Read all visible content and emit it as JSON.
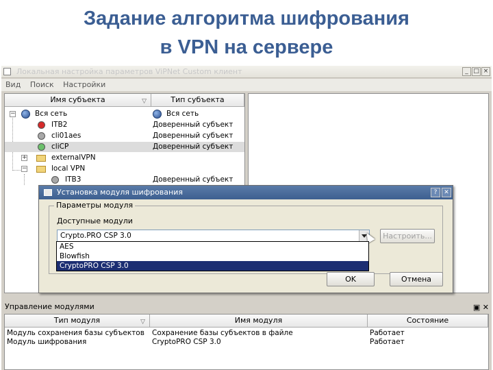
{
  "slide": {
    "title_line1": "Задание алгоритма шифрования",
    "title_line2": "в VPN на сервере"
  },
  "window": {
    "title": "Локальная настройка параметров ViPNet Custom клиент",
    "buttons": [
      "_",
      "□",
      "×"
    ]
  },
  "menu": [
    "Вид",
    "Поиск",
    "Настройки"
  ],
  "tree": {
    "headers": {
      "name": "Имя субъекта",
      "type": "Тип субъекта"
    },
    "rows": [
      {
        "name": "Вся сеть",
        "type": "Вся сеть",
        "icon": "globe-icon"
      },
      {
        "name": "ITB2",
        "type": "Доверенный субъект",
        "icon": "red-status-icon"
      },
      {
        "name": "cli01aes",
        "type": "Доверенный субъект",
        "icon": "gray-status-icon"
      },
      {
        "name": "cliCP",
        "type": "Доверенный субъект",
        "icon": "green-status-icon"
      },
      {
        "name": "externalVPN",
        "type": "",
        "icon": "folder-icon"
      },
      {
        "name": "local VPN",
        "type": "",
        "icon": "folder-icon"
      },
      {
        "name": "ITB3",
        "type": "Доверенный субъект",
        "icon": "gray-status-icon"
      }
    ]
  },
  "dialog": {
    "title": "Установка модуля шифрования",
    "group_label": "Параметры модуля",
    "available_label": "Доступные модули",
    "combo_value": "Crypto.PRO CSP 3.0",
    "configure_button": "Настроить...",
    "ok_button": "OK",
    "cancel_button": "Отмена",
    "options": [
      "AES",
      "Blowfish",
      "CryptoPRO CSP 3.0"
    ]
  },
  "bottom": {
    "title": "Управление модулями",
    "headers": {
      "type": "Тип модуля",
      "name": "Имя модуля",
      "state": "Состояние"
    },
    "rows": [
      {
        "type": "Модуль сохранения базы субъектов",
        "name": "Сохранение базы субъектов в файле",
        "state": "Работает"
      },
      {
        "type": "Модуль шифрования",
        "name": "CryptoPRO CSP 3.0",
        "state": "Работает"
      }
    ]
  }
}
